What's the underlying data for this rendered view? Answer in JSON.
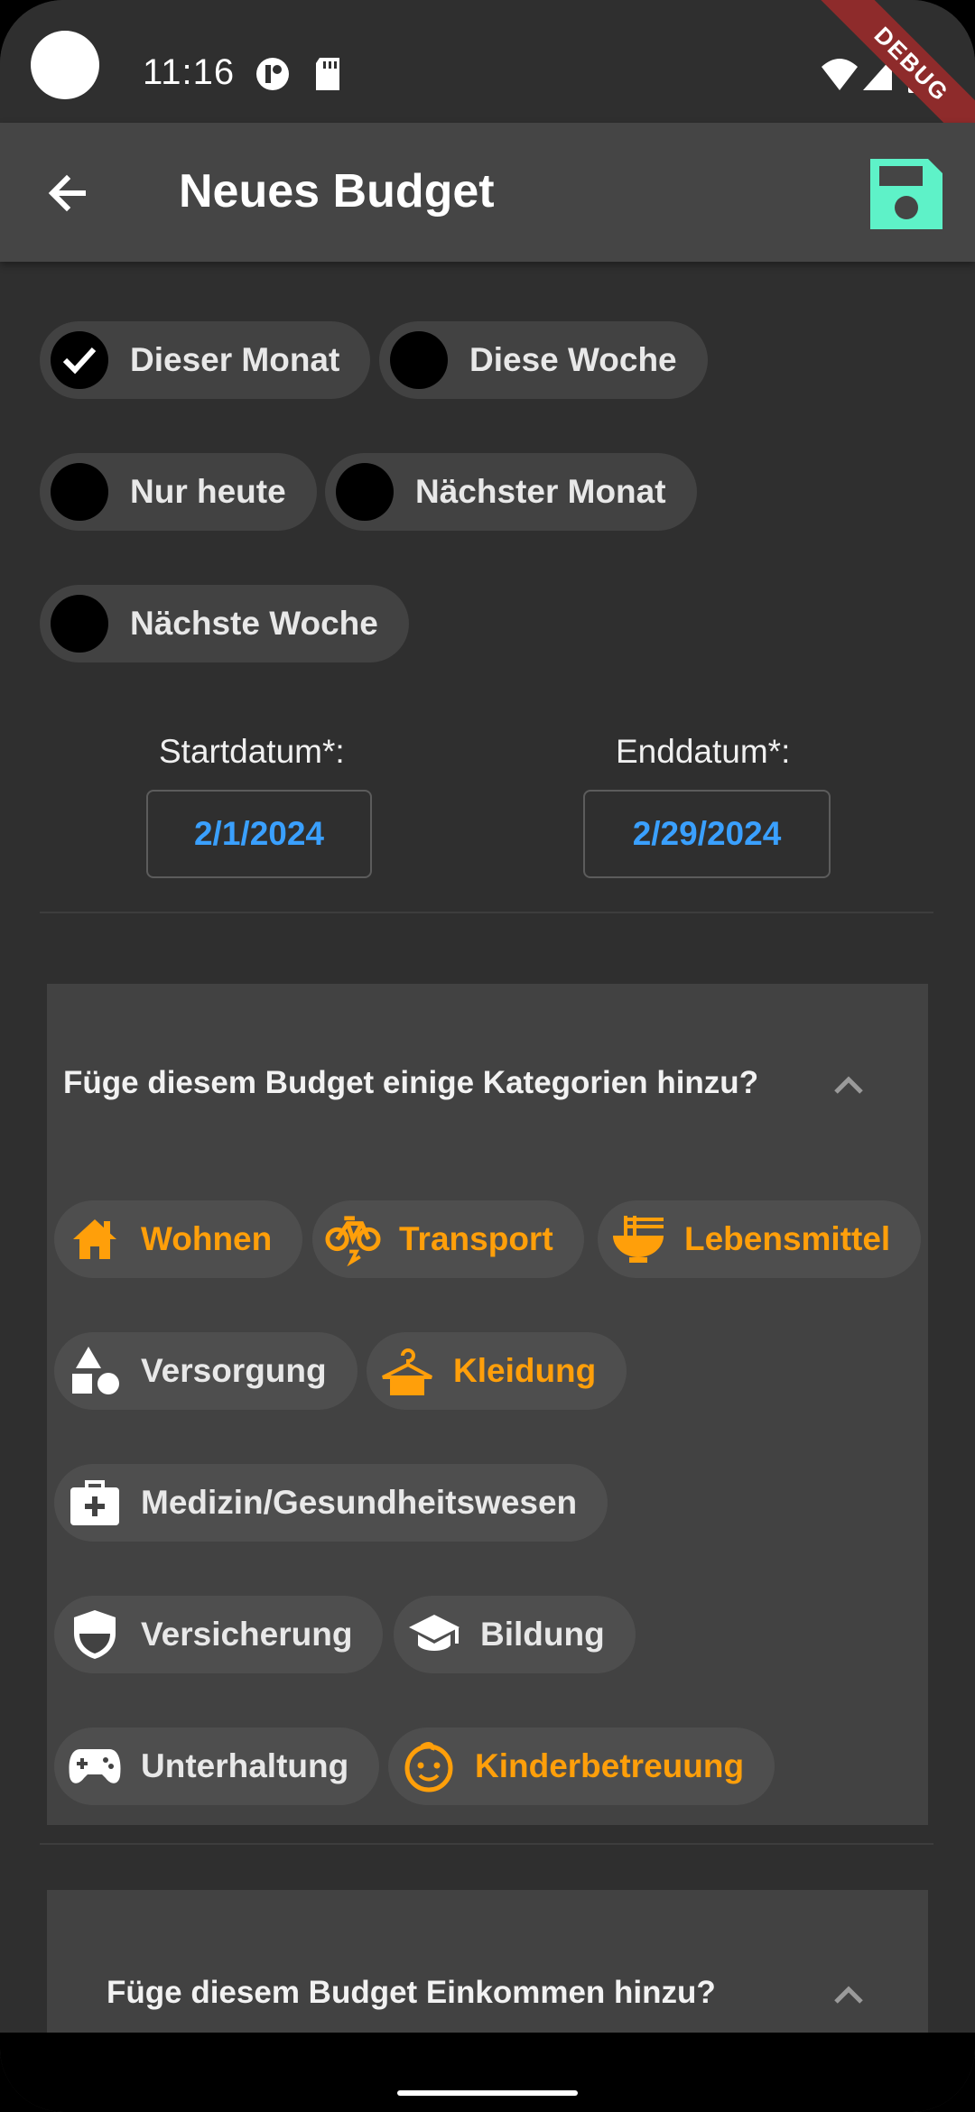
{
  "status_bar": {
    "time": "11:16",
    "debug_banner": "DEBUG"
  },
  "app_bar": {
    "title": "Neues Budget",
    "back_icon": "arrow-back-icon",
    "save_icon": "floppy-disk-icon",
    "save_color": "#5ef2c8"
  },
  "period_options": [
    {
      "label": "Dieser Monat",
      "selected": true
    },
    {
      "label": "Diese Woche",
      "selected": false
    },
    {
      "label": "Nur heute",
      "selected": false
    },
    {
      "label": "Nächster Monat",
      "selected": false
    },
    {
      "label": "Nächste Woche",
      "selected": false
    }
  ],
  "dates": {
    "start_label": "Startdatum*:",
    "start_value": "2/1/2024",
    "end_label": "Enddatum*:",
    "end_value": "2/29/2024"
  },
  "categories_panel": {
    "title": "Füge diesem Budget einige Kategorien hinzu?",
    "items": [
      {
        "label": "Wohnen",
        "icon": "house-icon",
        "selected": true
      },
      {
        "label": "Transport",
        "icon": "bicycle-icon",
        "selected": true
      },
      {
        "label": "Lebensmittel",
        "icon": "noodle-bowl-icon",
        "selected": true
      },
      {
        "label": "Versorgung",
        "icon": "shapes-icon",
        "selected": false
      },
      {
        "label": "Kleidung",
        "icon": "clothes-hanger-icon",
        "selected": true
      },
      {
        "label": "Medizin/Gesundheitswesen",
        "icon": "medical-bag-icon",
        "selected": false
      },
      {
        "label": "Versicherung",
        "icon": "shield-icon",
        "selected": false
      },
      {
        "label": "Bildung",
        "icon": "graduation-cap-icon",
        "selected": false
      },
      {
        "label": "Unterhaltung",
        "icon": "gamepad-icon",
        "selected": false
      },
      {
        "label": "Kinderbetreuung",
        "icon": "child-face-icon",
        "selected": true
      }
    ]
  },
  "income_panel": {
    "title": "Füge diesem Budget Einkommen hinzu?"
  },
  "colors": {
    "accent_selected": "#ff9f0a",
    "date_value": "#3aa0ff",
    "background": "#2f2f2f"
  }
}
